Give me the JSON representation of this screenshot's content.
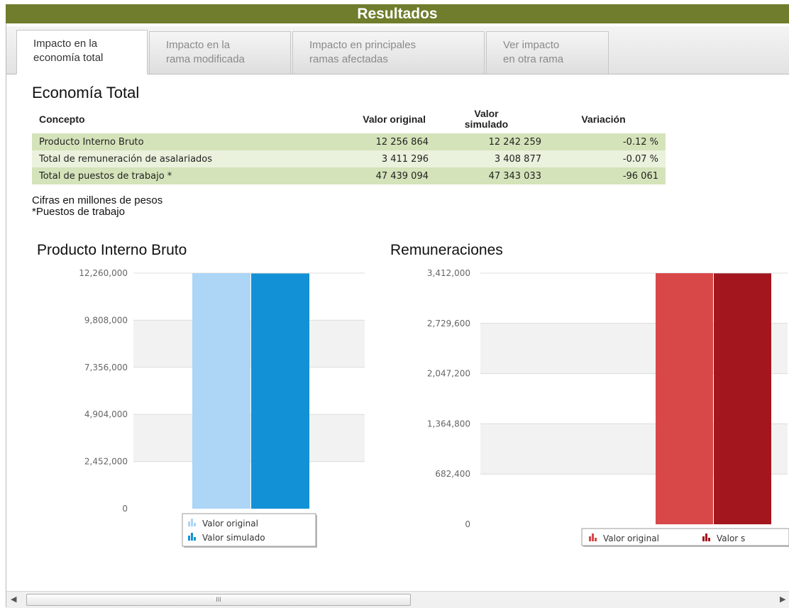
{
  "header": {
    "title": "Resultados"
  },
  "tabs": [
    {
      "line1": "Impacto en la",
      "line2": "economía total",
      "active": true
    },
    {
      "line1": "Impacto en la",
      "line2": "rama modificada",
      "active": false
    },
    {
      "line1": "Impacto en principales",
      "line2": "ramas afectadas",
      "active": false
    },
    {
      "line1": "Ver impacto",
      "line2": "en otra rama",
      "active": false
    }
  ],
  "section": {
    "title": "Economía Total"
  },
  "table": {
    "headers": {
      "concepto": "Concepto",
      "original": "Valor original",
      "simulado_l1": "Valor",
      "simulado_l2": "simulado",
      "variacion": "Variación"
    },
    "rows": [
      {
        "concepto": "Producto Interno Bruto",
        "original": "12 256 864",
        "simulado": "12 242 259",
        "variacion": "-0.12 %"
      },
      {
        "concepto": "Total de remuneración de asalariados",
        "original": "3 411 296",
        "simulado": "3 408 877",
        "variacion": "-0.07 %"
      },
      {
        "concepto": "Total de puestos de trabajo *",
        "original": "47 439 094",
        "simulado": "47 343 033",
        "variacion": "-96 061"
      }
    ]
  },
  "notes": {
    "line1": "Cifras en millones de pesos",
    "line2": "*Puestos de trabajo"
  },
  "colors": {
    "header": "#6f7d2c",
    "row_dark": "#d5e3ba",
    "row_light": "#eaf1dc"
  },
  "chart_data": [
    {
      "type": "bar",
      "title": "Producto Interno Bruto",
      "ylim": [
        0,
        12260000
      ],
      "yticks": [
        "12,260,000",
        "9,808,000",
        "7,356,000",
        "4,904,000",
        "2,452,000",
        "0"
      ],
      "series": [
        {
          "name": "Valor original",
          "values": [
            12256864
          ],
          "color": "#acd5f6"
        },
        {
          "name": "Valor simulado",
          "values": [
            12242259
          ],
          "color": "#1291d6"
        }
      ],
      "legend": "bottom"
    },
    {
      "type": "bar",
      "title": "Remuneraciones",
      "ylim": [
        0,
        3412000
      ],
      "yticks": [
        "3,412,000",
        "2,729,600",
        "2,047,200",
        "1,364,800",
        "682,400",
        "0"
      ],
      "series": [
        {
          "name": "Valor original",
          "values": [
            3411296
          ],
          "color": "#d84848"
        },
        {
          "name": "Valor simulado",
          "values": [
            3408877
          ],
          "color": "#a3161d"
        }
      ],
      "legend": "bottom",
      "legend_text_visible": [
        "Valor original",
        "Valor s"
      ]
    }
  ],
  "scrollbar": {
    "left_arrow": "◀",
    "right_arrow": "▶",
    "grip": "III"
  }
}
